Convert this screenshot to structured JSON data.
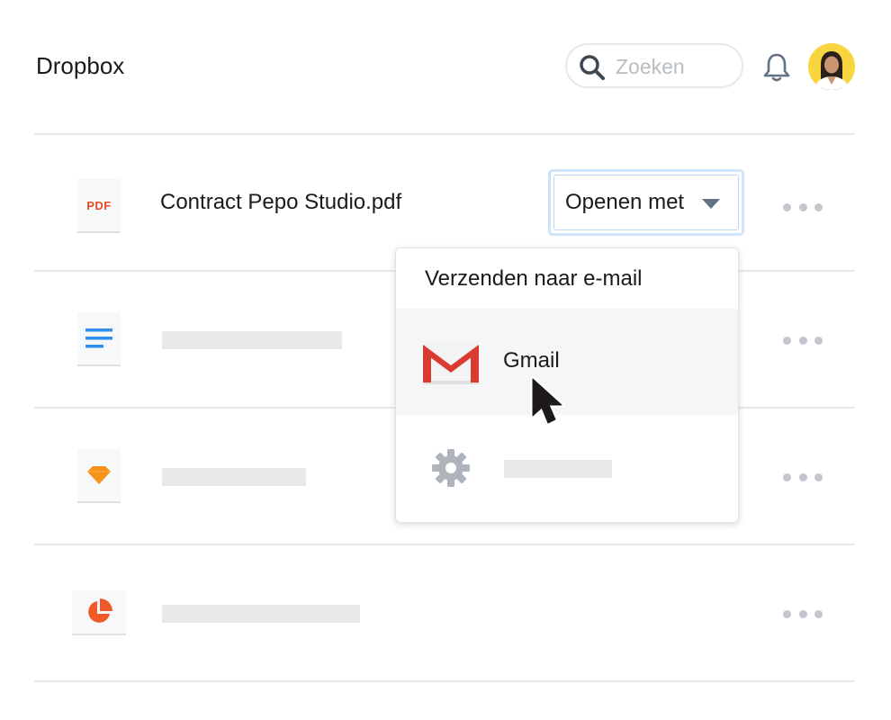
{
  "header": {
    "app_title": "Dropbox",
    "search": {
      "value": "",
      "placeholder": "Zoeken",
      "icon": "search-icon"
    },
    "notifications_icon": "bell-icon",
    "avatar_icon": "user-avatar"
  },
  "files": [
    {
      "name": "Contract Pepo Studio.pdf",
      "type_label": "PDF",
      "icon": "pdf-file-icon"
    },
    {
      "name": "",
      "icon": "document-file-icon"
    },
    {
      "name": "",
      "icon": "sketch-file-icon"
    },
    {
      "name": "",
      "icon": "chart-file-icon"
    }
  ],
  "open_with": {
    "label": "Openen met",
    "menu": {
      "header": "Verzenden naar e-mail",
      "items": [
        {
          "label": "Gmail",
          "icon": "gmail-icon",
          "state": "hover"
        },
        {
          "label": "",
          "icon": "gear-icon"
        }
      ]
    }
  },
  "colors": {
    "accent_focus": "#bcd7f8",
    "pdf_red": "#e24d29",
    "doc_blue": "#2f8fef",
    "sketch_orange": "#f7931a",
    "chart_red": "#f05a28",
    "gmail_red": "#d93b30",
    "muted_gray": "#c1c7cd"
  }
}
